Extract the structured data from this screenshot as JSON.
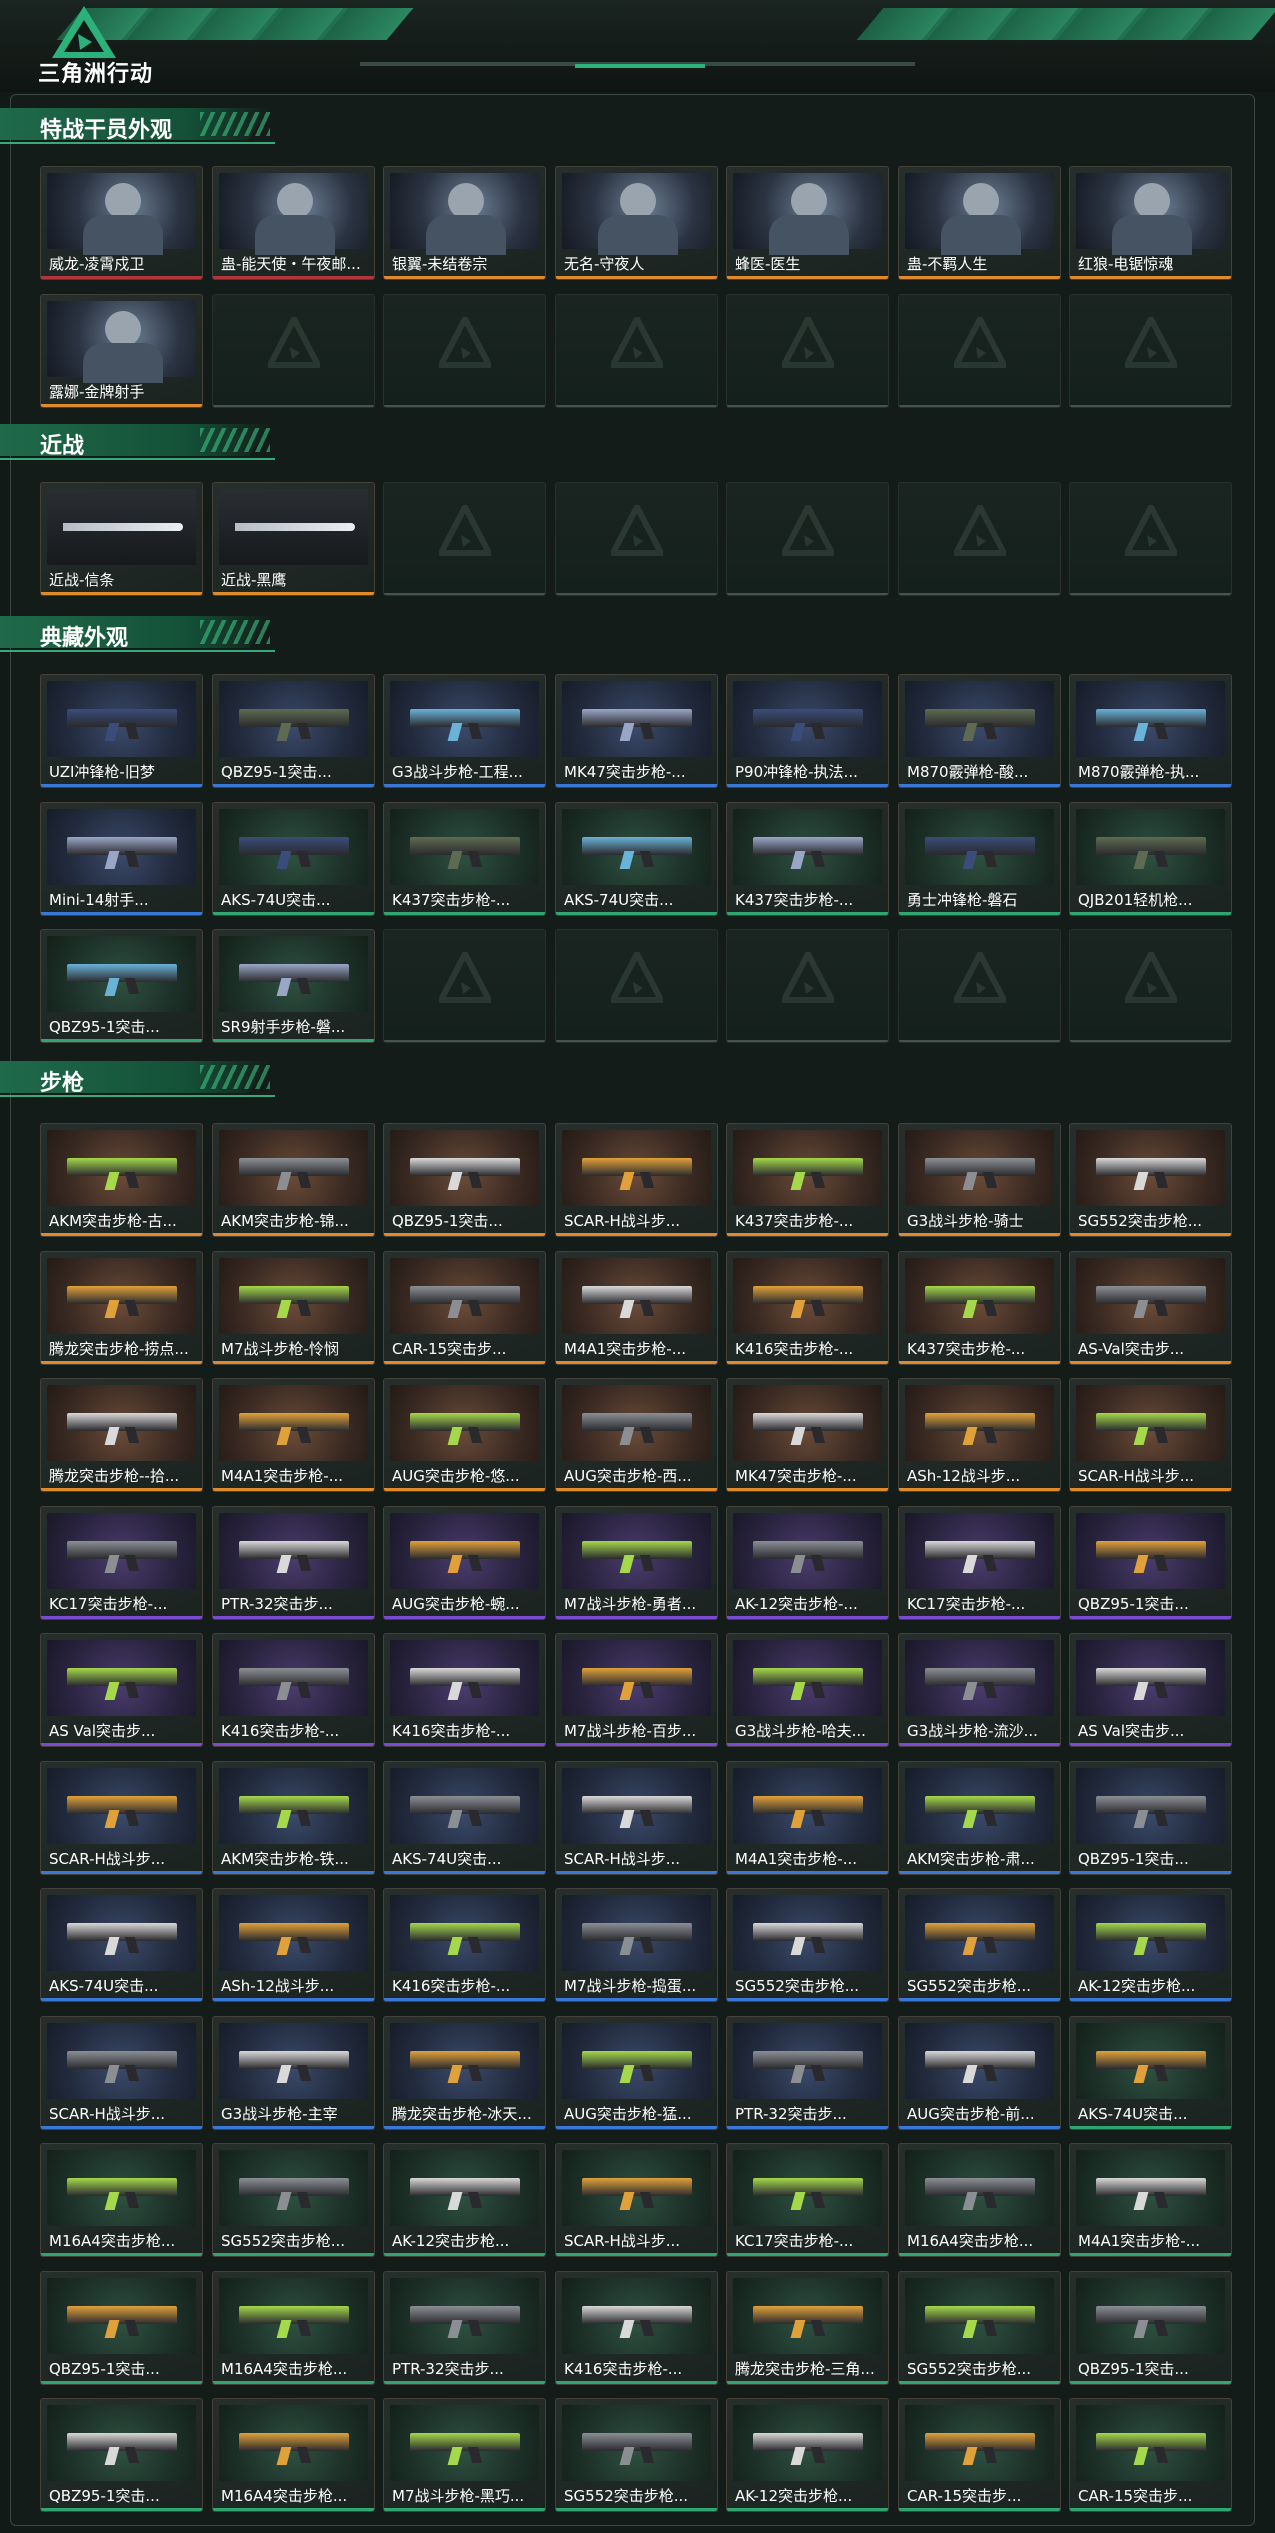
{
  "app": {
    "title": "三角洲行动"
  },
  "sections": [
    {
      "title": "特战干员外观",
      "items": [
        {
          "name": "威龙-凌霄戍卫",
          "rarity": "red",
          "kind": "operator"
        },
        {
          "name": "蛊-能天使・午夜邮...",
          "rarity": "red",
          "kind": "operator"
        },
        {
          "name": "银翼-未结卷宗",
          "rarity": "orange",
          "kind": "operator"
        },
        {
          "name": "无名-守夜人",
          "rarity": "orange",
          "kind": "operator"
        },
        {
          "name": "蜂医-医生",
          "rarity": "orange",
          "kind": "operator"
        },
        {
          "name": "蛊-不羁人生",
          "rarity": "orange",
          "kind": "operator"
        },
        {
          "name": "红狼-电锯惊魂",
          "rarity": "orange",
          "kind": "operator"
        },
        {
          "name": "露娜-金牌射手",
          "rarity": "orange",
          "kind": "operator"
        }
      ],
      "empty_slots": 6
    },
    {
      "title": "近战",
      "items": [
        {
          "name": "近战-信条",
          "rarity": "orange",
          "kind": "melee"
        },
        {
          "name": "近战-黑鹰",
          "rarity": "orange",
          "kind": "melee"
        }
      ],
      "empty_slots": 5
    },
    {
      "title": "典藏外观",
      "items": [
        {
          "name": "UZI冲锋枪-旧梦",
          "rarity": "blue",
          "kind": "gun"
        },
        {
          "name": "QBZ95-1突击...",
          "rarity": "blue",
          "kind": "gun"
        },
        {
          "name": "G3战斗步枪-工程...",
          "rarity": "blue",
          "kind": "gun"
        },
        {
          "name": "MK47突击步枪-...",
          "rarity": "blue",
          "kind": "gun"
        },
        {
          "name": "P90冲锋枪-执法...",
          "rarity": "blue",
          "kind": "gun"
        },
        {
          "name": "M870霰弹枪-酸...",
          "rarity": "blue",
          "kind": "gun"
        },
        {
          "name": "M870霰弹枪-执...",
          "rarity": "blue",
          "kind": "gun"
        },
        {
          "name": "Mini-14射手...",
          "rarity": "blue",
          "kind": "gun"
        },
        {
          "name": "AKS-74U突击...",
          "rarity": "green",
          "kind": "gun"
        },
        {
          "name": "K437突击步枪-...",
          "rarity": "green",
          "kind": "gun"
        },
        {
          "name": "AKS-74U突击...",
          "rarity": "green",
          "kind": "gun"
        },
        {
          "name": "K437突击步枪-...",
          "rarity": "green",
          "kind": "gun"
        },
        {
          "name": "勇士冲锋枪-磐石",
          "rarity": "green",
          "kind": "gun"
        },
        {
          "name": "QJB201轻机枪...",
          "rarity": "green",
          "kind": "gun"
        },
        {
          "name": "QBZ95-1突击...",
          "rarity": "green",
          "kind": "gun"
        },
        {
          "name": "SR9射手步枪-磐...",
          "rarity": "green",
          "kind": "gun"
        }
      ],
      "empty_slots": 5
    },
    {
      "title": "步枪",
      "items": [
        {
          "name": "AKM突击步枪-古...",
          "rarity": "orange",
          "kind": "gun"
        },
        {
          "name": "AKM突击步枪-锦...",
          "rarity": "orange",
          "kind": "gun"
        },
        {
          "name": "QBZ95-1突击...",
          "rarity": "orange",
          "kind": "gun"
        },
        {
          "name": "SCAR-H战斗步...",
          "rarity": "orange",
          "kind": "gun"
        },
        {
          "name": "K437突击步枪-...",
          "rarity": "orange",
          "kind": "gun"
        },
        {
          "name": "G3战斗步枪-骑士",
          "rarity": "orange",
          "kind": "gun"
        },
        {
          "name": "SG552突击步枪...",
          "rarity": "orange",
          "kind": "gun"
        },
        {
          "name": "腾龙突击步枪-捞点...",
          "rarity": "orange",
          "kind": "gun"
        },
        {
          "name": "M7战斗步枪-怜悯",
          "rarity": "orange",
          "kind": "gun"
        },
        {
          "name": "CAR-15突击步...",
          "rarity": "orange",
          "kind": "gun"
        },
        {
          "name": "M4A1突击步枪-...",
          "rarity": "orange",
          "kind": "gun"
        },
        {
          "name": "K416突击步枪-...",
          "rarity": "orange",
          "kind": "gun"
        },
        {
          "name": "K437突击步枪-...",
          "rarity": "orange",
          "kind": "gun"
        },
        {
          "name": "AS-Val突击步...",
          "rarity": "orange",
          "kind": "gun"
        },
        {
          "name": "腾龙突击步枪--拾...",
          "rarity": "orange",
          "kind": "gun"
        },
        {
          "name": "M4A1突击步枪-...",
          "rarity": "orange",
          "kind": "gun"
        },
        {
          "name": "AUG突击步枪-悠...",
          "rarity": "orange",
          "kind": "gun"
        },
        {
          "name": "AUG突击步枪-西...",
          "rarity": "orange",
          "kind": "gun"
        },
        {
          "name": "MK47突击步枪-...",
          "rarity": "orange",
          "kind": "gun"
        },
        {
          "name": "ASh-12战斗步...",
          "rarity": "orange",
          "kind": "gun"
        },
        {
          "name": "SCAR-H战斗步...",
          "rarity": "orange",
          "kind": "gun"
        },
        {
          "name": "KC17突击步枪-...",
          "rarity": "purple",
          "kind": "gun"
        },
        {
          "name": "PTR-32突击步...",
          "rarity": "purple",
          "kind": "gun"
        },
        {
          "name": "AUG突击步枪-蜿...",
          "rarity": "purple",
          "kind": "gun"
        },
        {
          "name": "M7战斗步枪-勇者...",
          "rarity": "purple",
          "kind": "gun"
        },
        {
          "name": "AK-12突击步枪-...",
          "rarity": "purple",
          "kind": "gun"
        },
        {
          "name": "KC17突击步枪-...",
          "rarity": "purple",
          "kind": "gun"
        },
        {
          "name": "QBZ95-1突击...",
          "rarity": "purple",
          "kind": "gun"
        },
        {
          "name": "AS Val突击步...",
          "rarity": "purple",
          "kind": "gun"
        },
        {
          "name": "K416突击步枪-...",
          "rarity": "purple",
          "kind": "gun"
        },
        {
          "name": "K416突击步枪-...",
          "rarity": "purple",
          "kind": "gun"
        },
        {
          "name": "M7战斗步枪-百步...",
          "rarity": "purple",
          "kind": "gun"
        },
        {
          "name": "G3战斗步枪-哈夫...",
          "rarity": "purple",
          "kind": "gun"
        },
        {
          "name": "G3战斗步枪-流沙...",
          "rarity": "purple",
          "kind": "gun"
        },
        {
          "name": "AS Val突击步...",
          "rarity": "purple",
          "kind": "gun"
        },
        {
          "name": "SCAR-H战斗步...",
          "rarity": "blue",
          "kind": "gun"
        },
        {
          "name": "AKM突击步枪-铁...",
          "rarity": "blue",
          "kind": "gun"
        },
        {
          "name": "AKS-74U突击...",
          "rarity": "blue",
          "kind": "gun"
        },
        {
          "name": "SCAR-H战斗步...",
          "rarity": "blue",
          "kind": "gun"
        },
        {
          "name": "M4A1突击步枪-...",
          "rarity": "blue",
          "kind": "gun"
        },
        {
          "name": "AKM突击步枪-肃...",
          "rarity": "blue",
          "kind": "gun"
        },
        {
          "name": "QBZ95-1突击...",
          "rarity": "blue",
          "kind": "gun"
        },
        {
          "name": "AKS-74U突击...",
          "rarity": "blue",
          "kind": "gun"
        },
        {
          "name": "ASh-12战斗步...",
          "rarity": "blue",
          "kind": "gun"
        },
        {
          "name": "K416突击步枪-...",
          "rarity": "blue",
          "kind": "gun"
        },
        {
          "name": "M7战斗步枪-捣蛋...",
          "rarity": "blue",
          "kind": "gun"
        },
        {
          "name": "SG552突击步枪...",
          "rarity": "blue",
          "kind": "gun"
        },
        {
          "name": "SG552突击步枪...",
          "rarity": "blue",
          "kind": "gun"
        },
        {
          "name": "AK-12突击步枪...",
          "rarity": "blue",
          "kind": "gun"
        },
        {
          "name": "SCAR-H战斗步...",
          "rarity": "blue",
          "kind": "gun"
        },
        {
          "name": "G3战斗步枪-主宰",
          "rarity": "blue",
          "kind": "gun"
        },
        {
          "name": "腾龙突击步枪-冰天...",
          "rarity": "blue",
          "kind": "gun"
        },
        {
          "name": "AUG突击步枪-猛...",
          "rarity": "blue",
          "kind": "gun"
        },
        {
          "name": "PTR-32突击步...",
          "rarity": "blue",
          "kind": "gun"
        },
        {
          "name": "AUG突击步枪-前...",
          "rarity": "blue",
          "kind": "gun"
        },
        {
          "name": "AKS-74U突击...",
          "rarity": "green",
          "kind": "gun"
        },
        {
          "name": "M16A4突击步枪...",
          "rarity": "green",
          "kind": "gun"
        },
        {
          "name": "SG552突击步枪...",
          "rarity": "green",
          "kind": "gun"
        },
        {
          "name": "AK-12突击步枪...",
          "rarity": "green",
          "kind": "gun"
        },
        {
          "name": "SCAR-H战斗步...",
          "rarity": "green",
          "kind": "gun"
        },
        {
          "name": "KC17突击步枪-...",
          "rarity": "green",
          "kind": "gun"
        },
        {
          "name": "M16A4突击步枪...",
          "rarity": "green",
          "kind": "gun"
        },
        {
          "name": "M4A1突击步枪-...",
          "rarity": "green",
          "kind": "gun"
        },
        {
          "name": "QBZ95-1突击...",
          "rarity": "green",
          "kind": "gun"
        },
        {
          "name": "M16A4突击步枪...",
          "rarity": "green",
          "kind": "gun"
        },
        {
          "name": "PTR-32突击步...",
          "rarity": "green",
          "kind": "gun"
        },
        {
          "name": "K416突击步枪-...",
          "rarity": "green",
          "kind": "gun"
        },
        {
          "name": "腾龙突击步枪-三角...",
          "rarity": "green",
          "kind": "gun"
        },
        {
          "name": "SG552突击步枪...",
          "rarity": "green",
          "kind": "gun"
        },
        {
          "name": "QBZ95-1突击...",
          "rarity": "green",
          "kind": "gun"
        },
        {
          "name": "QBZ95-1突击...",
          "rarity": "green",
          "kind": "gun"
        },
        {
          "name": "M16A4突击步枪...",
          "rarity": "green",
          "kind": "gun"
        },
        {
          "name": "M7战斗步枪-黑巧...",
          "rarity": "green",
          "kind": "gun"
        },
        {
          "name": "SG552突击步枪...",
          "rarity": "green",
          "kind": "gun"
        },
        {
          "name": "AK-12突击步枪...",
          "rarity": "green",
          "kind": "gun"
        },
        {
          "name": "CAR-15突击步...",
          "rarity": "green",
          "kind": "gun"
        },
        {
          "name": "CAR-15突击步...",
          "rarity": "green",
          "kind": "gun"
        }
      ],
      "empty_slots": 0
    }
  ],
  "colors": {
    "rarity_orange": "#e08a2b",
    "rarity_red": "#b5343a",
    "rarity_purple": "#7a4bd2",
    "rarity_blue": "#3a78d8",
    "rarity_green": "#2fa56f",
    "accent": "#2db17a"
  },
  "gun_colors": [
    "#8b8f94",
    "#c96a2c",
    "#3a4d7a",
    "#d9d9d9",
    "#b63a45",
    "#5e6b52",
    "#e0a13a",
    "#d86aa8",
    "#6ab2d8",
    "#a5d84b",
    "#2e2e33",
    "#9aa6c6"
  ]
}
